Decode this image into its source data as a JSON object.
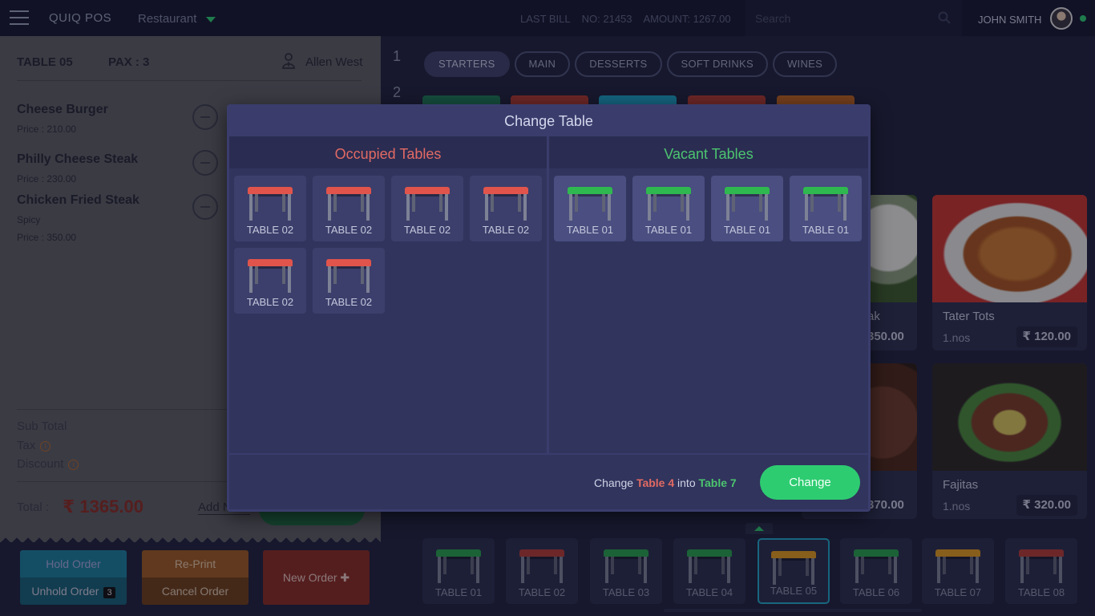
{
  "topbar": {
    "brand": "QUIQ POS",
    "department": "Restaurant",
    "last_bill_label": "LAST BILL",
    "bill_no": "NO: 21453",
    "amount": "AMOUNT: 1267.00",
    "search_placeholder": "Search",
    "user_name": "JOHN SMITH"
  },
  "order": {
    "table": "TABLE 05",
    "pax": "PAX : 3",
    "waiter": "Allen West",
    "items": [
      {
        "name": "Cheese Burger",
        "price": "Price  : 210.00"
      },
      {
        "name": "Philly Cheese Steak",
        "price": "Price  : 230.00"
      },
      {
        "name": "Chicken Fried Steak",
        "note": "Spicy",
        "price": "Price  : 350.00"
      }
    ],
    "sub_total_label": "Sub Total",
    "tax_label": "Tax",
    "discount_label": "Discount",
    "total_label": "Total :",
    "total_value": "₹ 1365.00",
    "add_note": "Add Note"
  },
  "actions": {
    "hold": "Hold Order",
    "unhold": "Unhold Order",
    "unhold_count": "3",
    "reprint": "Re-Print",
    "cancel": "Cancel Order",
    "new_order": "New Order ✚"
  },
  "row_numbers": [
    "1",
    "2"
  ],
  "categories": [
    "STARTERS",
    "MAIN",
    "DESSERTS",
    "SOFT DRINKS",
    "WINES"
  ],
  "category_colors": [
    "#1d7a55",
    "#b0392f",
    "#1aa0c4",
    "#b0392f",
    "#c0651f"
  ],
  "foods": [
    {
      "name": "Tater Tots",
      "qty": "1.nos",
      "price": "₹ 120.00"
    },
    {
      "name": "Fajitas",
      "qty": "1.nos",
      "price": "₹ 320.00"
    }
  ],
  "partial_foods": {
    "name_tail": "ak",
    "price1_tail": "350.00",
    "price2_tail": "370.00"
  },
  "bottom_tables": [
    {
      "label": "TABLE 01",
      "color": "#27a04a"
    },
    {
      "label": "TABLE 02",
      "color": "#b43c35"
    },
    {
      "label": "TABLE 03",
      "color": "#27a04a"
    },
    {
      "label": "TABLE 04",
      "color": "#27a04a"
    },
    {
      "label": "TABLE 05",
      "color": "#e09a1c"
    },
    {
      "label": "TABLE 06",
      "color": "#27a04a"
    },
    {
      "label": "TABLE 07",
      "color": "#e09a1c"
    },
    {
      "label": "TABLE 08",
      "color": "#b43c35"
    }
  ],
  "modal": {
    "title": "Change Table",
    "occupied_title": "Occupied Tables",
    "vacant_title": "Vacant Tables",
    "occupied": [
      "TABLE 02",
      "TABLE 02",
      "TABLE 02",
      "TABLE 02",
      "TABLE 02",
      "TABLE 02"
    ],
    "vacant": [
      "TABLE 01",
      "TABLE 01",
      "TABLE 01",
      "TABLE 01"
    ],
    "occupied_color": "#e0544c",
    "vacant_color": "#2fb84f",
    "change_prefix": "Change",
    "from_table": "Table 4",
    "into": "into",
    "to_table": "Table 7",
    "change_button": "Change"
  }
}
